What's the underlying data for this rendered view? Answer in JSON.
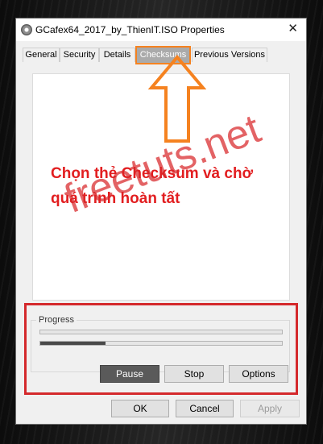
{
  "window": {
    "title": "GCafex64_2017_by_ThienIT.ISO Properties",
    "close_glyph": "✕"
  },
  "tabs": [
    {
      "label": "General",
      "active": false
    },
    {
      "label": "Security",
      "active": false
    },
    {
      "label": "Details",
      "active": false
    },
    {
      "label": "Checksums",
      "active": true
    },
    {
      "label": "Previous Versions",
      "active": false
    }
  ],
  "annotation": {
    "line1": "Chọn thẻ Checksum và chờ",
    "line2": "quá trình hoàn tất",
    "color": "#e21e20"
  },
  "watermark": {
    "text": "freetuts.net",
    "color": "#d9282b"
  },
  "progress": {
    "label": "Progress",
    "bars": [
      {
        "value": 0
      },
      {
        "value": 0.27
      }
    ]
  },
  "actions": {
    "pause": "Pause",
    "stop": "Stop",
    "options": "Options"
  },
  "dialog_buttons": {
    "ok": "OK",
    "cancel": "Cancel",
    "apply": "Apply",
    "apply_enabled": false
  },
  "colors": {
    "tab_highlight": "#f58220",
    "arrow": "#f58220",
    "highlight_box": "#d4292c"
  },
  "icons": {
    "title": "disc-icon",
    "close": "close-icon",
    "arrow": "arrow-up-icon"
  }
}
